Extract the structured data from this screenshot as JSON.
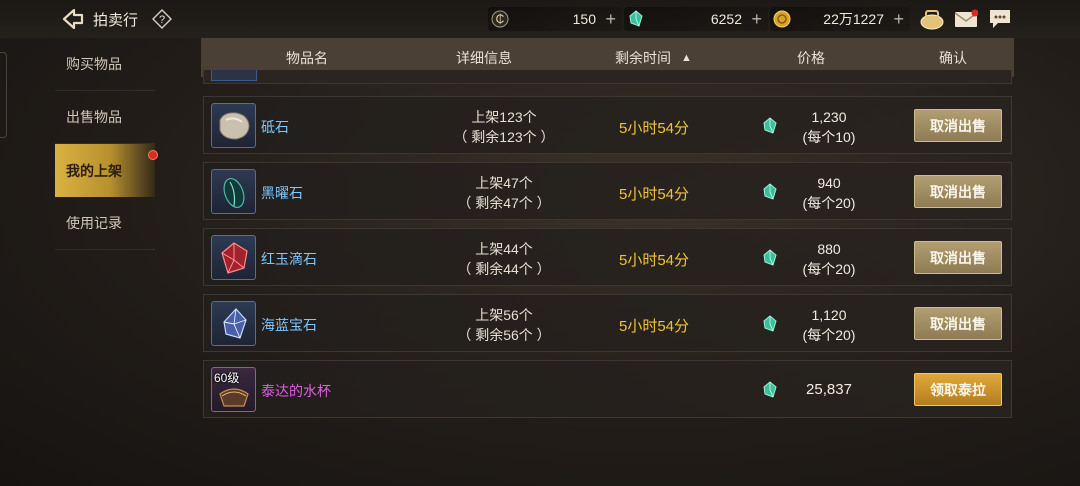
{
  "header": {
    "title": "拍卖行",
    "help_label": "?",
    "currencies": [
      {
        "name": "c-coin-icon",
        "value": "150"
      },
      {
        "name": "green-gem-icon",
        "value": "6252"
      },
      {
        "name": "gold-coin-icon",
        "value": "22万1227"
      }
    ],
    "plus": "+"
  },
  "sidebar": {
    "items": [
      {
        "label": "购买物品"
      },
      {
        "label": "出售物品"
      },
      {
        "label": "我的上架"
      },
      {
        "label": "使用记录"
      }
    ]
  },
  "table": {
    "headers": {
      "name": "物品名",
      "detail": "详细信息",
      "time": "剩余时间",
      "price": "价格",
      "confirm": "确认"
    },
    "sort_arrow": "▲",
    "rows": [
      {
        "name": "砥石",
        "listed": "上架123个",
        "remaining": "（ 剩余123个 ）",
        "time": "5小时54分",
        "price": "1,230",
        "unit_price": "(每个10)",
        "action": "取消出售"
      },
      {
        "name": "黑曜石",
        "listed": "上架47个",
        "remaining": "（ 剩余47个 ）",
        "time": "5小时54分",
        "price": "940",
        "unit_price": "(每个20)",
        "action": "取消出售"
      },
      {
        "name": "红玉滴石",
        "listed": "上架44个",
        "remaining": "（ 剩余44个 ）",
        "time": "5小时54分",
        "price": "880",
        "unit_price": "(每个20)",
        "action": "取消出售"
      },
      {
        "name": "海蓝宝石",
        "listed": "上架56个",
        "remaining": "（ 剩余56个 ）",
        "time": "5小时54分",
        "price": "1,120",
        "unit_price": "(每个20)",
        "action": "取消出售"
      }
    ],
    "sold_row": {
      "level": "60级",
      "name": "泰达的水杯",
      "price": "25,837",
      "action": "领取泰拉"
    }
  },
  "colors": {
    "accent_gold": "#d9b242",
    "time_yellow": "#f0c43a",
    "item_blue": "#7fc7ff",
    "item_purple": "#e05de8"
  }
}
